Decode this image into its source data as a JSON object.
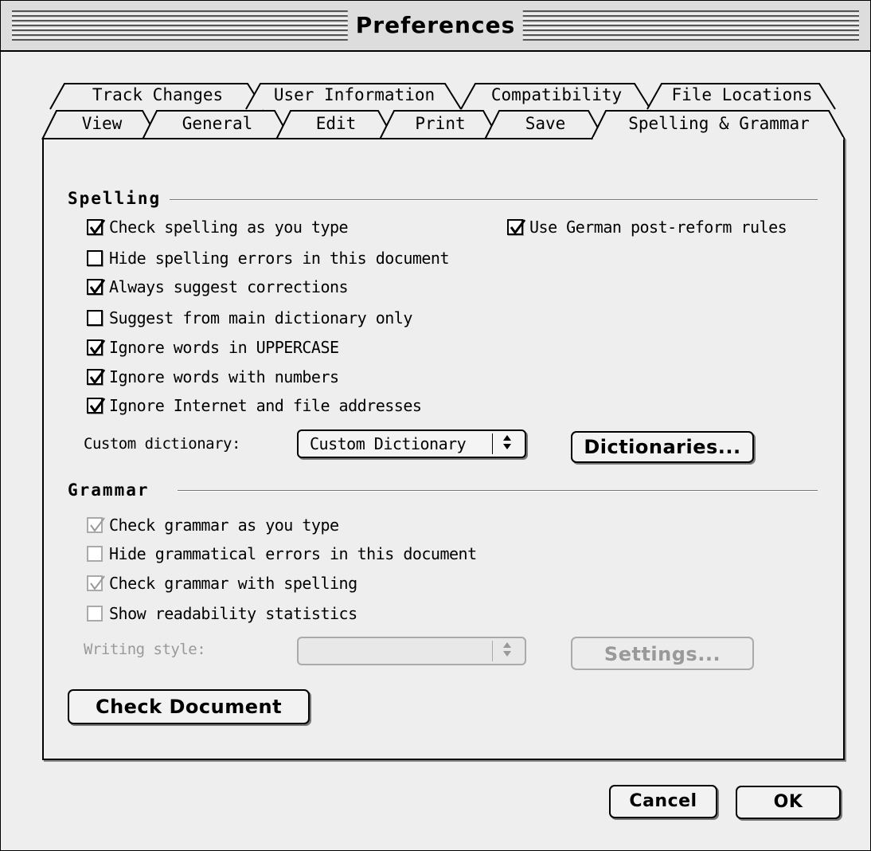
{
  "window": {
    "title": "Preferences"
  },
  "tabs": {
    "row1": [
      "Track Changes",
      "User Information",
      "Compatibility",
      "File Locations"
    ],
    "row2": [
      "View",
      "General",
      "Edit",
      "Print",
      "Save",
      "Spelling & Grammar"
    ],
    "active": "Spelling & Grammar"
  },
  "spelling": {
    "heading": "Spelling",
    "options": [
      {
        "label": "Check spelling as you type",
        "checked": true
      },
      {
        "label": "Hide spelling errors in this document",
        "checked": false
      },
      {
        "label": "Always suggest corrections",
        "checked": true
      },
      {
        "label": "Suggest from main dictionary only",
        "checked": false
      },
      {
        "label": "Ignore words in UPPERCASE",
        "checked": true
      },
      {
        "label": "Ignore words with numbers",
        "checked": true
      },
      {
        "label": "Ignore Internet and file addresses",
        "checked": true
      }
    ],
    "german": {
      "label": "Use German post-reform rules",
      "checked": true
    },
    "custom_dictionary_label": "Custom dictionary:",
    "custom_dictionary_value": "Custom Dictionary",
    "dictionaries_button": "Dictionaries..."
  },
  "grammar": {
    "heading": "Grammar",
    "options": [
      {
        "label": "Check grammar as you type",
        "checked": true,
        "disabled": true
      },
      {
        "label": "Hide grammatical errors in this document",
        "checked": false,
        "disabled": true
      },
      {
        "label": "Check grammar with spelling",
        "checked": true,
        "disabled": true
      },
      {
        "label": "Show readability statistics",
        "checked": false,
        "disabled": true
      }
    ],
    "writing_style_label": "Writing style:",
    "writing_style_value": "",
    "settings_button": "Settings..."
  },
  "check_document_button": "Check Document",
  "cancel_button": "Cancel",
  "ok_button": "OK",
  "icons": {
    "checkmark": "checkmark-icon",
    "popup_arrows": "updown-arrows-icon"
  }
}
